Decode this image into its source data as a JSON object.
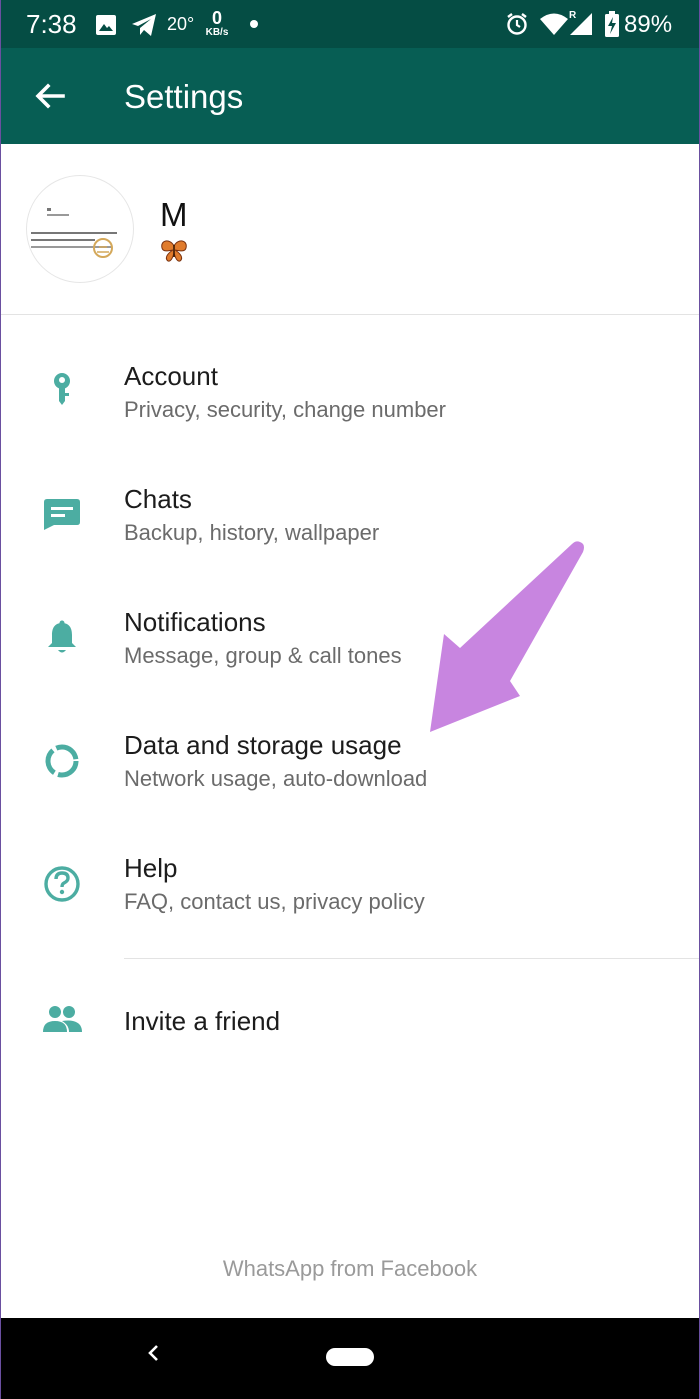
{
  "status_bar": {
    "time": "7:38",
    "temperature": "20°",
    "net_speed_value": "0",
    "net_speed_unit": "KB/s",
    "battery": "89%",
    "icons": [
      "image-icon",
      "telegram-icon",
      "alarm-icon",
      "wifi-icon",
      "signal-icon",
      "battery-charging-icon"
    ]
  },
  "app_bar": {
    "title": "Settings",
    "back_icon": "arrow-left-icon"
  },
  "profile": {
    "name": "M",
    "status_icon": "butterfly-icon"
  },
  "settings": [
    {
      "title": "Account",
      "subtitle": "Privacy, security, change number",
      "icon": "key-icon"
    },
    {
      "title": "Chats",
      "subtitle": "Backup, history, wallpaper",
      "icon": "chat-icon"
    },
    {
      "title": "Notifications",
      "subtitle": "Message, group & call tones",
      "icon": "bell-icon"
    },
    {
      "title": "Data and storage usage",
      "subtitle": "Network usage, auto-download",
      "icon": "data-usage-icon"
    },
    {
      "title": "Help",
      "subtitle": "FAQ, contact us, privacy policy",
      "icon": "help-icon"
    },
    {
      "title": "Invite a friend",
      "icon": "people-icon"
    }
  ],
  "footer": "WhatsApp from Facebook",
  "colors": {
    "status_bar": "#054d44",
    "app_bar": "#075e54",
    "icon_teal": "#4cada2",
    "annotation_arrow": "#c885e0"
  }
}
